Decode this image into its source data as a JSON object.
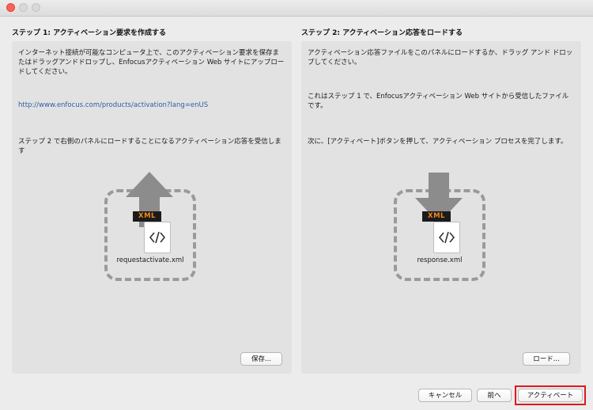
{
  "window": {
    "buttons": {
      "close": "close",
      "minimize": "minimize",
      "maximize": "maximize"
    }
  },
  "step1": {
    "title": "ステップ 1: アクティベーション要求を作成する",
    "description": "インターネット接続が可能なコンピュータ上で、このアクティベーション要求を保存またはドラッグアンドドロップし、Enfocusアクティベーション Web サイトにアップロードしてください。",
    "url": "http://www.enfocus.com/products/activation?lang=enUS",
    "note": "ステップ 2 で右側のパネルにロードすることになるアクティベーション応答を受信します",
    "file_badge": "XML",
    "file_name": "requestactivate.xml",
    "save_button": "保存..."
  },
  "step2": {
    "title": "ステップ 2: アクティベーション応答をロードする",
    "description": "アクティベーション応答ファイルをこのパネルにロードするか、ドラッグ アンド ドロップしてください。",
    "note1": "これはステップ 1 で、Enfocusアクティベーション Web サイトから受信したファイルです。",
    "note2": "次に、[アクティベート]ボタンを押して、アクティベーション プロセスを完了します。",
    "file_badge": "XML",
    "file_name": "response.xml",
    "load_button": "ロード..."
  },
  "footer": {
    "cancel": "キャンセル",
    "back": "前へ",
    "activate": "アクティベート"
  },
  "colors": {
    "highlight": "#e0181e",
    "link": "#2c5ea8",
    "xml_badge_text": "#f08a1c"
  }
}
